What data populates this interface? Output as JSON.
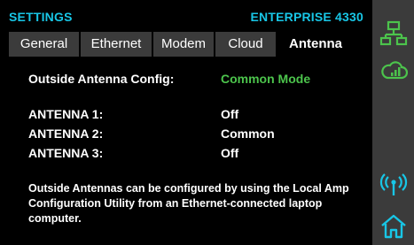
{
  "header": {
    "title": "SETTINGS",
    "device": "ENTERPRISE 4330"
  },
  "tabs": [
    {
      "label": "General",
      "active": false
    },
    {
      "label": "Ethernet",
      "active": false
    },
    {
      "label": "Modem",
      "active": false
    },
    {
      "label": "Cloud",
      "active": false
    },
    {
      "label": "Antenna",
      "active": true
    }
  ],
  "content": {
    "config_label": "Outside Antenna Config:",
    "config_value": "Common Mode",
    "antennas": [
      {
        "label": "ANTENNA 1:",
        "value": "Off"
      },
      {
        "label": "ANTENNA 2:",
        "value": "Common"
      },
      {
        "label": "ANTENNA 3:",
        "value": "Off"
      }
    ],
    "note": "Outside Antennas can be configured by using the Local Amp Configuration Utility from an Ethernet-connected laptop computer."
  },
  "sidebar": {
    "icons": [
      "network-icon",
      "signal-bars-icon",
      "antenna-broadcast-icon",
      "home-icon"
    ]
  },
  "colors": {
    "accent": "#18c6e6",
    "green": "#4cc44c",
    "tab_inactive": "#3b3b3b",
    "sidebar_bg": "#3b3b3b"
  }
}
